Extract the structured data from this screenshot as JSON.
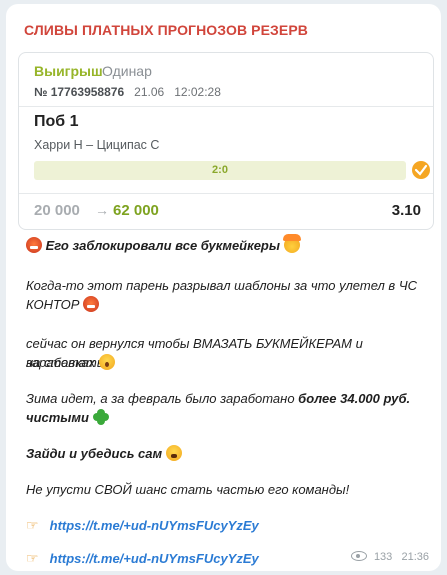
{
  "channel": {
    "name": "СЛИВЫ ПЛАТНЫХ ПРОГНОЗОВ РЕЗЕРВ"
  },
  "bet_card": {
    "status": "Выигрыш",
    "type": "Одинар",
    "id": "№ 17763958876",
    "date": "21.06",
    "time": "12:02:28",
    "outcome": "Поб 1",
    "match": "Харри Н – Циципас С",
    "score": "2:0",
    "stake": "20 000",
    "arrow": "→",
    "payout": "62 000",
    "odds": "3.10",
    "icon": "win-check-icon"
  },
  "message": {
    "line1": "Его заблокировали все букмейкеры",
    "line2a": "Когда-то этот парень разрывал шаблоны за что улетел в ЧС",
    "line2b": "КОНТОР",
    "line3a": "сейчас он вернулся чтобы ВМАЗАТЬ БУКМЕЙКЕРАМ  и заработать",
    "line3b": "на ставках",
    "line4a": "Зима идет, а за февраль было заработано ",
    "line4_bold": "более 34.000 руб.",
    "line4b": "чистыми",
    "line5": "Зайди и убедись сам",
    "line6": "Не упусти СВОЙ шанс стать частью его команды!",
    "link1": "https://t.me/+ud-nUYmsFUcyYzEy",
    "link2": "https://t.me/+ud-nUYmsFUcyYzEy"
  },
  "meta": {
    "views": "133",
    "time": "21:36"
  },
  "colors": {
    "channel": "#d1453b",
    "win": "#97b52a",
    "link": "#2b7bd4"
  }
}
